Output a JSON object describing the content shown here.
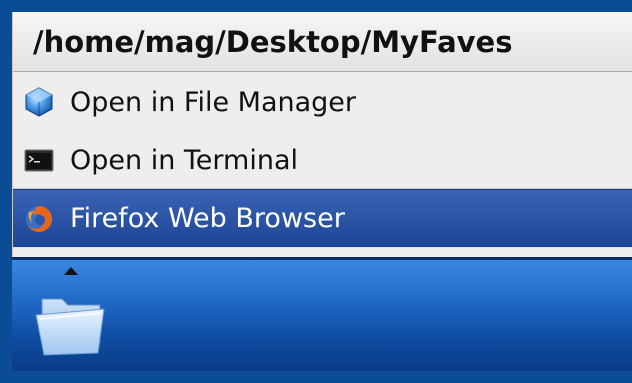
{
  "menu": {
    "title": "/home/mag/Desktop/MyFaves",
    "items": [
      {
        "label": "Open in File Manager",
        "icon": "file-manager-icon"
      },
      {
        "label": "Open in Terminal",
        "icon": "terminal-icon"
      },
      {
        "label": "Firefox Web Browser",
        "icon": "firefox-icon",
        "selected": true
      }
    ]
  },
  "panel": {
    "launcher_icon": "folder-icon"
  },
  "colors": {
    "desktop_background": "#0b4c97",
    "menu_background": "#eeeeee",
    "selection": "#2a53a8",
    "panel": "#1f67c3"
  }
}
